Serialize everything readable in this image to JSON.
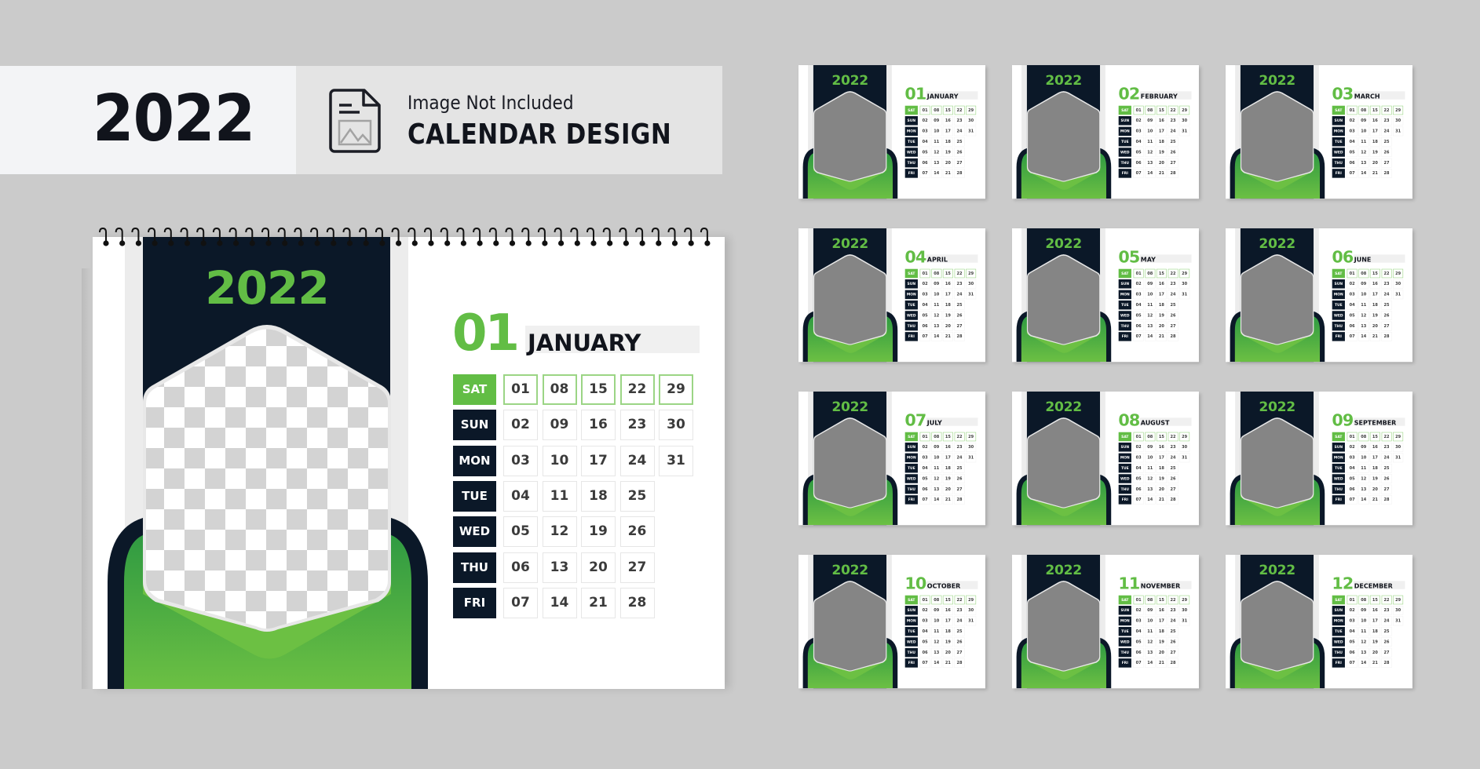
{
  "banner": {
    "year": "2022",
    "icon": "image-document-icon",
    "subtitle": "Image Not Included",
    "title": "CALENDAR DESIGN"
  },
  "colors": {
    "background": "#cbcbcb",
    "dark": "#0b1828",
    "green": "#62bd45",
    "green_dark": "#2f9a42",
    "text_dark": "#11141c"
  },
  "main_calendar": {
    "year": "2022",
    "photo_placeholder": "transparent-checkerboard",
    "month_number": "01",
    "month_name": "JANUARY",
    "rows": [
      {
        "day": "SAT",
        "dates": [
          "01",
          "08",
          "15",
          "22",
          "29"
        ]
      },
      {
        "day": "SUN",
        "dates": [
          "02",
          "09",
          "16",
          "23",
          "30"
        ]
      },
      {
        "day": "MON",
        "dates": [
          "03",
          "10",
          "17",
          "24",
          "31"
        ]
      },
      {
        "day": "TUE",
        "dates": [
          "04",
          "11",
          "18",
          "25"
        ]
      },
      {
        "day": "WED",
        "dates": [
          "05",
          "12",
          "19",
          "26"
        ]
      },
      {
        "day": "THU",
        "dates": [
          "06",
          "13",
          "20",
          "27"
        ]
      },
      {
        "day": "FRI",
        "dates": [
          "07",
          "14",
          "21",
          "28"
        ]
      }
    ]
  },
  "mini_calendars": [
    {
      "year": "2022",
      "month_number": "01",
      "month_name": "JANUARY"
    },
    {
      "year": "2022",
      "month_number": "02",
      "month_name": "FEBRUARY"
    },
    {
      "year": "2022",
      "month_number": "03",
      "month_name": "MARCH"
    },
    {
      "year": "2022",
      "month_number": "04",
      "month_name": "APRIL"
    },
    {
      "year": "2022",
      "month_number": "05",
      "month_name": "MAY"
    },
    {
      "year": "2022",
      "month_number": "06",
      "month_name": "JUNE"
    },
    {
      "year": "2022",
      "month_number": "07",
      "month_name": "JULY"
    },
    {
      "year": "2022",
      "month_number": "08",
      "month_name": "AUGUST"
    },
    {
      "year": "2022",
      "month_number": "09",
      "month_name": "SEPTEMBER"
    },
    {
      "year": "2022",
      "month_number": "10",
      "month_name": "OCTOBER"
    },
    {
      "year": "2022",
      "month_number": "11",
      "month_name": "NOVEMBER"
    },
    {
      "year": "2022",
      "month_number": "12",
      "month_name": "DECEMBER"
    }
  ],
  "mini_rows_template": [
    {
      "day": "SAT",
      "dates": [
        "01",
        "08",
        "15",
        "22",
        "29"
      ]
    },
    {
      "day": "SUN",
      "dates": [
        "02",
        "09",
        "16",
        "23",
        "30"
      ]
    },
    {
      "day": "MON",
      "dates": [
        "03",
        "10",
        "17",
        "24",
        "31"
      ]
    },
    {
      "day": "TUE",
      "dates": [
        "04",
        "11",
        "18",
        "25"
      ]
    },
    {
      "day": "WED",
      "dates": [
        "05",
        "12",
        "19",
        "26"
      ]
    },
    {
      "day": "THU",
      "dates": [
        "06",
        "13",
        "20",
        "27"
      ]
    },
    {
      "day": "FRI",
      "dates": [
        "07",
        "14",
        "21",
        "28"
      ]
    }
  ]
}
